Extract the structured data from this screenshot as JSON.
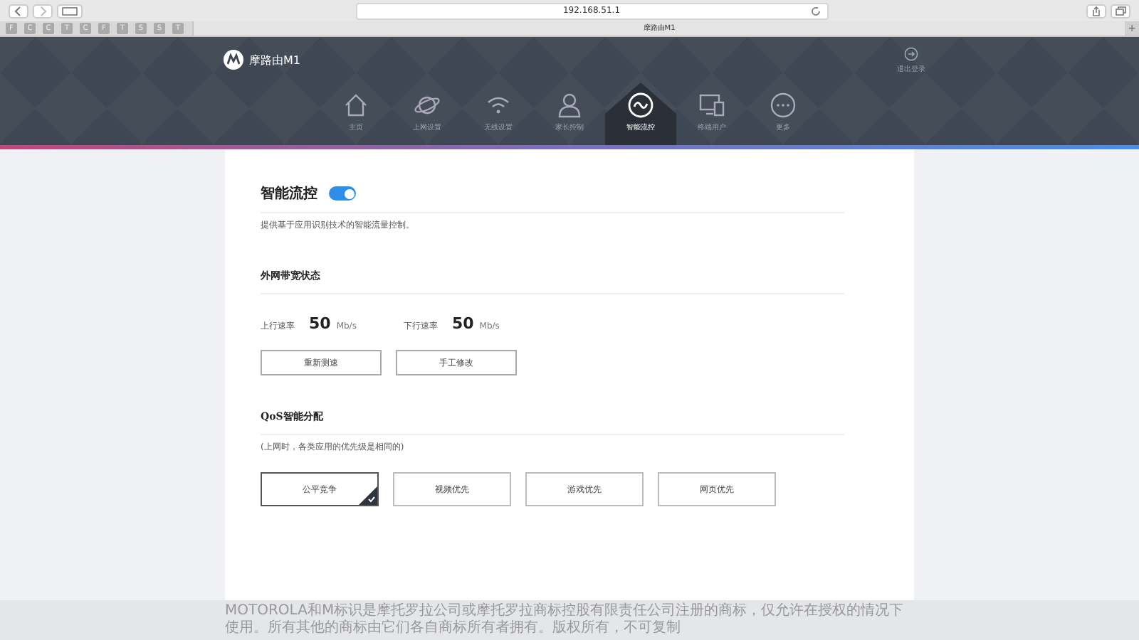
{
  "browser": {
    "url": "192.168.51.1",
    "bookmarks": [
      "F",
      "C",
      "C",
      "T",
      "C",
      "F",
      "T",
      "S",
      "S",
      "T"
    ],
    "tab_title": "摩路由M1",
    "new_tab": "+"
  },
  "header": {
    "brand": "摩路由M1",
    "logout": "退出登录"
  },
  "nav": [
    {
      "label": "主页",
      "selected": false
    },
    {
      "label": "上网设置",
      "selected": false
    },
    {
      "label": "无线设置",
      "selected": false
    },
    {
      "label": "家长控制",
      "selected": false
    },
    {
      "label": "智能流控",
      "selected": true
    },
    {
      "label": "终端用户",
      "selected": false
    },
    {
      "label": "更多",
      "selected": false
    }
  ],
  "smart_control": {
    "title": "智能流控",
    "on": true,
    "description": "提供基于应用识别技术的智能流量控制。"
  },
  "bandwidth": {
    "title": "外网带宽状态",
    "speeds": [
      {
        "label": "上行速率",
        "value": "50",
        "unit": "Mb/s"
      },
      {
        "label": "下行速率",
        "value": "50",
        "unit": "Mb/s"
      }
    ],
    "buttons": [
      "重新测速",
      "手工修改"
    ]
  },
  "qos": {
    "title": "QoS智能分配",
    "description": "(上网时，各类应用的优先级是相同的)",
    "options": [
      {
        "label": "公平竞争",
        "selected": true
      },
      {
        "label": "视频优先",
        "selected": false
      },
      {
        "label": "游戏优先",
        "selected": false
      },
      {
        "label": "网页优先",
        "selected": false
      }
    ]
  },
  "footer": "MOTOROLA和M标识是摩托罗拉公司或摩托罗拉商标控股有限责任公司注册的商标，仅允许在授权的情况下使用。所有其他的商标由它们各自商标所有者拥有。版权所有，不可复制"
}
